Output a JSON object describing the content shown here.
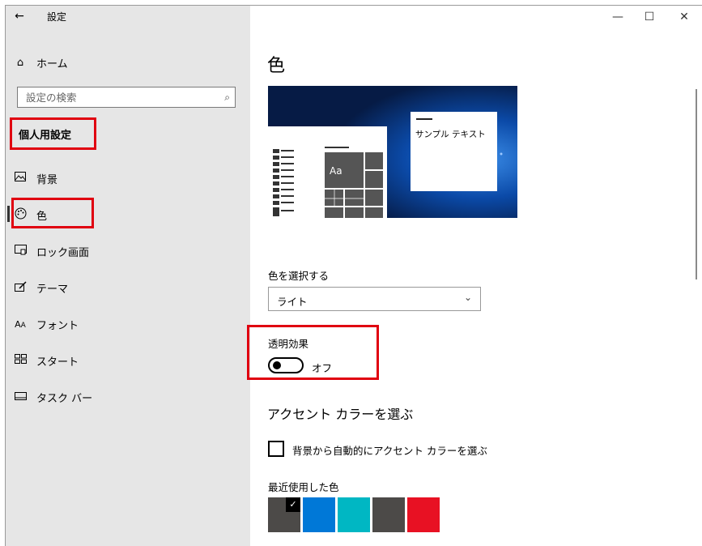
{
  "window": {
    "title": "設定",
    "back_icon": "←",
    "minimize_icon": "—",
    "maximize_icon": "☐",
    "close_icon": "✕"
  },
  "sidebar": {
    "home_label": "ホーム",
    "home_icon": "⌂",
    "search_placeholder": "設定の検索",
    "search_icon": "⌕",
    "section_title": "個人用設定",
    "items": [
      {
        "label": "背景",
        "icon": "▭"
      },
      {
        "label": "色",
        "icon": "⚙"
      },
      {
        "label": "ロック画面",
        "icon": "▭"
      },
      {
        "label": "テーマ",
        "icon": "✎"
      },
      {
        "label": "フォント",
        "icon": "A"
      },
      {
        "label": "スタート",
        "icon": "▦"
      },
      {
        "label": "タスク バー",
        "icon": "▭"
      }
    ],
    "selected_item": "色"
  },
  "main": {
    "title": "色",
    "preview": {
      "sample_text": "サンプル テキスト",
      "tile_label": "Aa"
    },
    "choose_color_label": "色を選択する",
    "choose_color_value": "ライト",
    "transparency_label": "透明効果",
    "transparency_state": "オフ",
    "transparency_on": false,
    "accent_heading": "アクセント カラーを選ぶ",
    "auto_accent_label": "背景から自動的にアクセント カラーを選ぶ",
    "auto_accent_checked": false,
    "recent_colors_label": "最近使用した色",
    "recent_colors": [
      "#4c4a48",
      "#0078d7",
      "#00b7c3",
      "#4c4a48",
      "#e81123"
    ],
    "selected_recent_color_index": 0,
    "check_icon": "✓",
    "dropdown_icon": "⌄"
  },
  "colors": {
    "annotation_red": "#e00010",
    "sidebar_bg": "#e6e6e6"
  }
}
